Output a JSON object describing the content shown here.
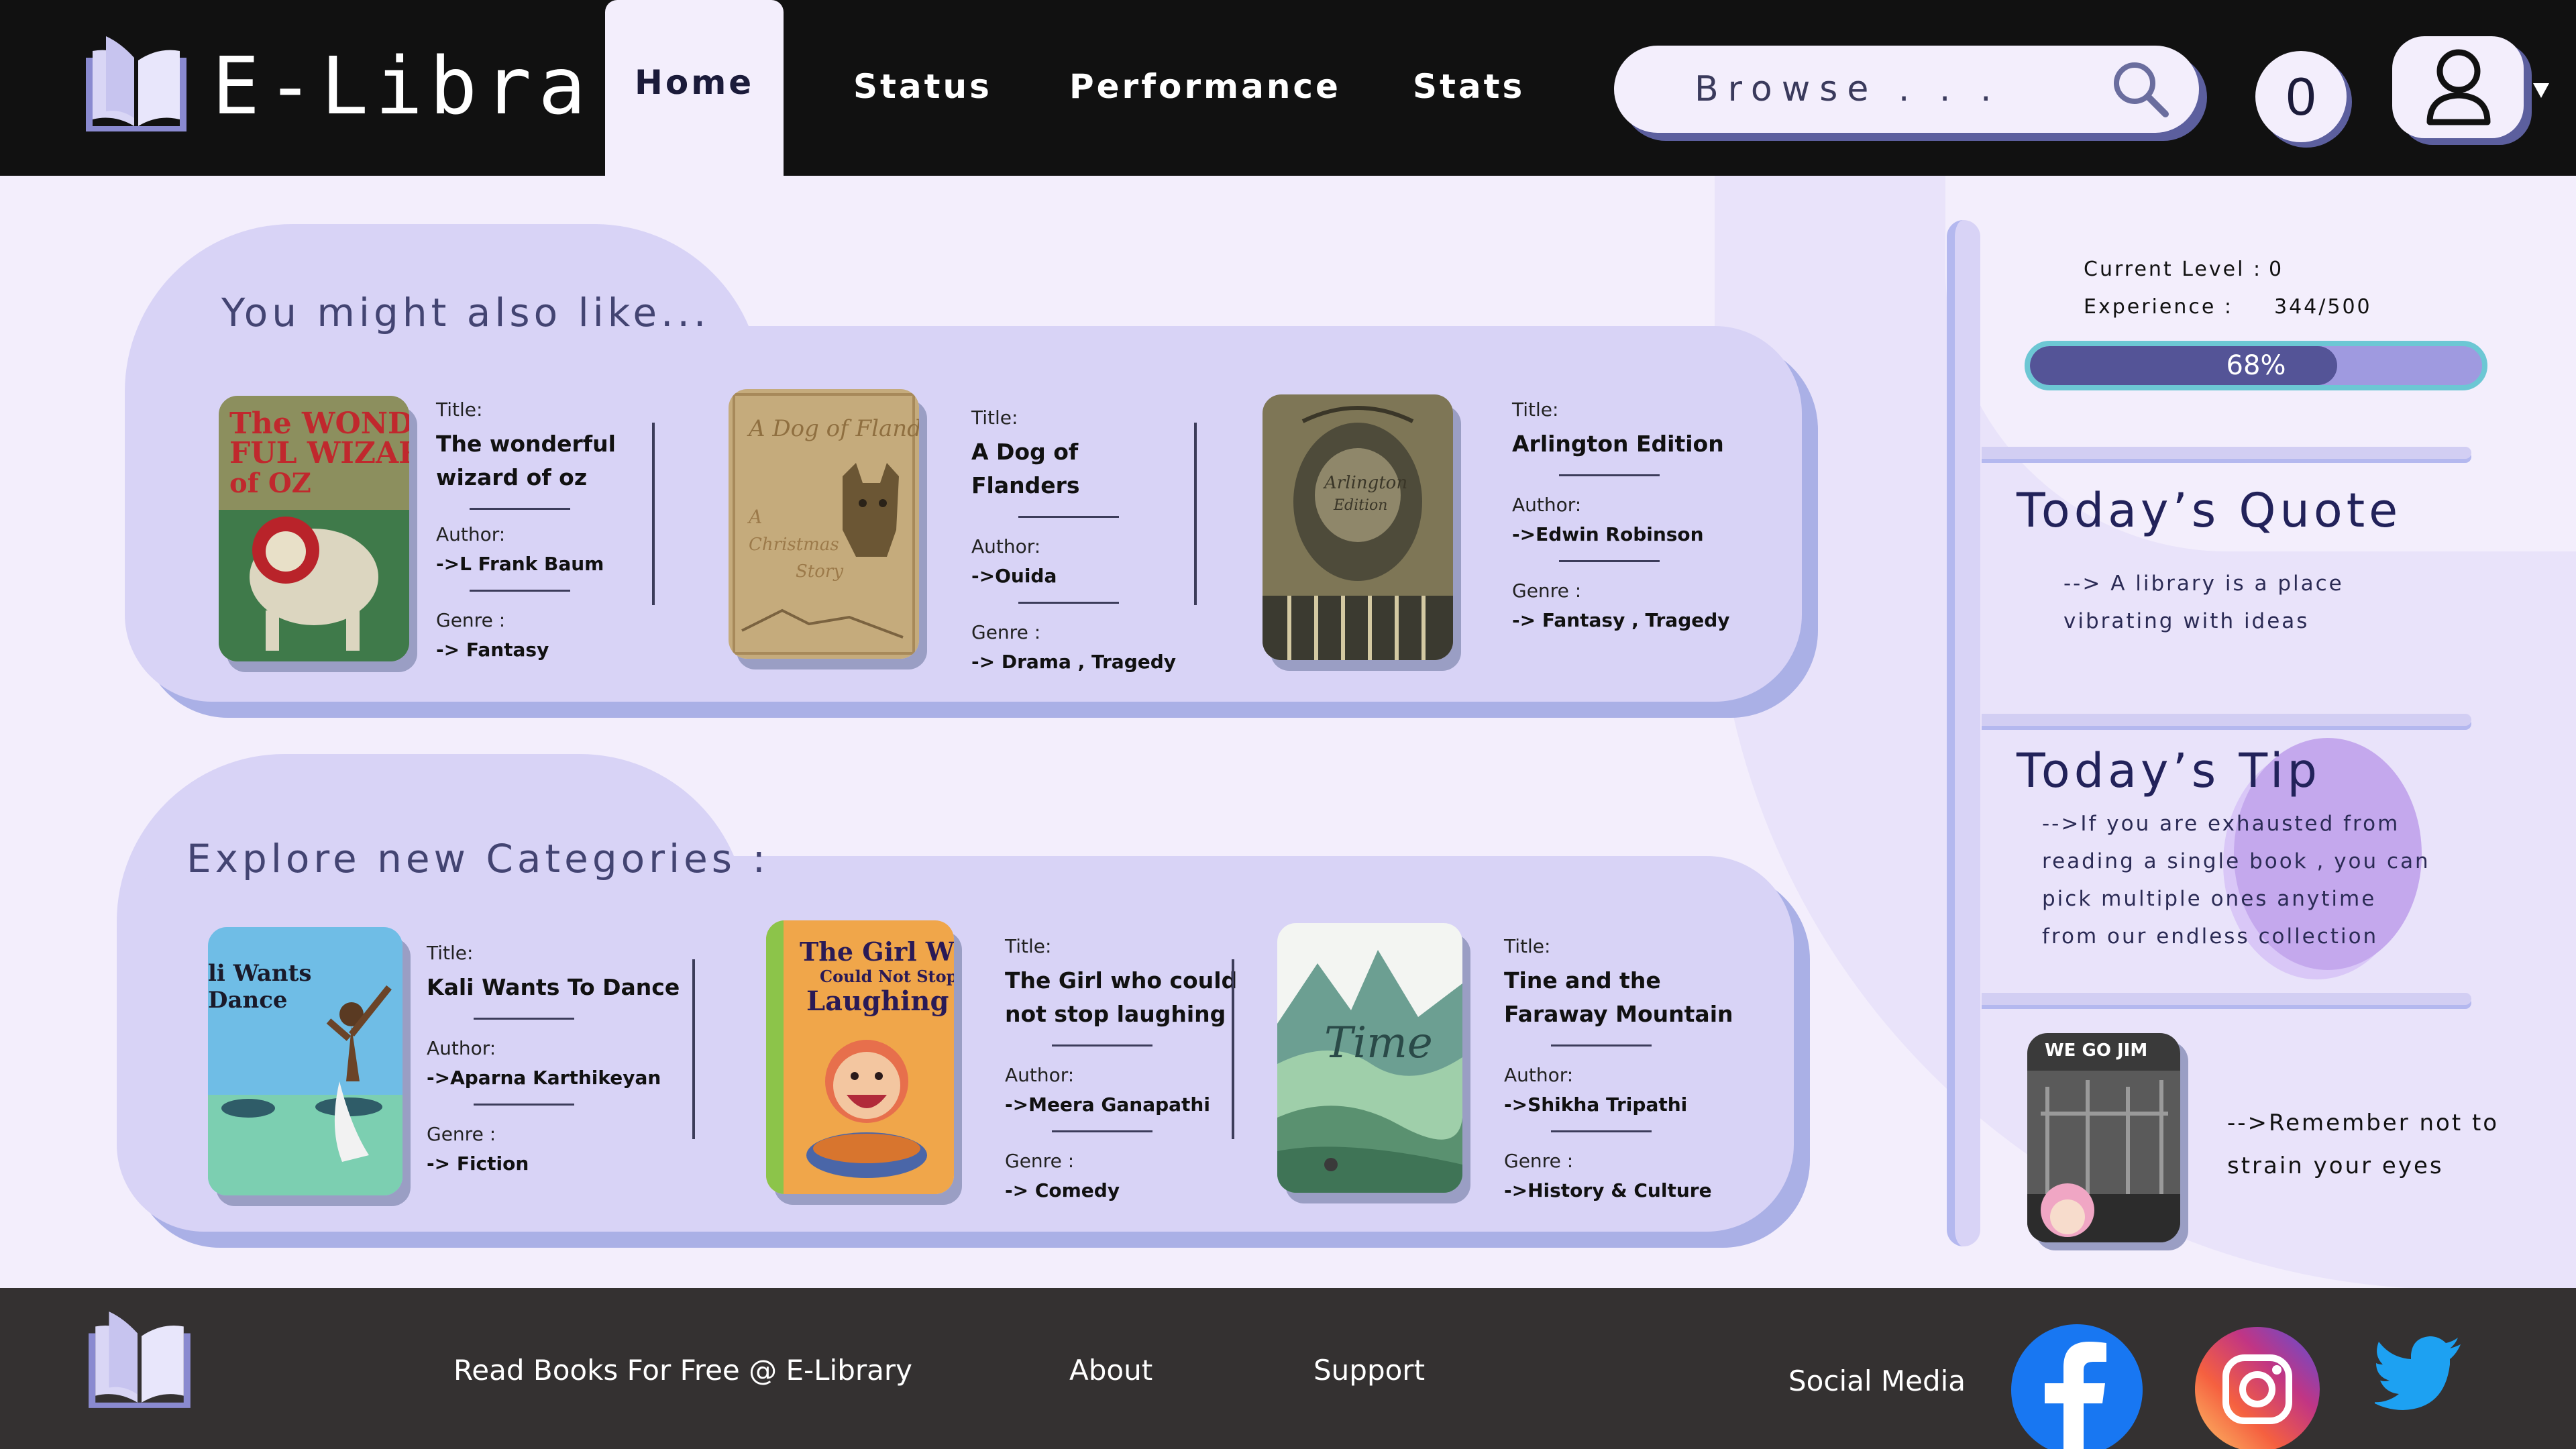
{
  "header": {
    "brand": "E-Library",
    "nav": [
      "Home",
      "Status",
      "Performance",
      "Stats"
    ],
    "search_placeholder": "Browse . . .",
    "notification_count": "0"
  },
  "recommendations": {
    "title": "You might also like...",
    "books": [
      {
        "title_label": "Title:",
        "title": "The wonderful wizard of oz",
        "author_label": "Author:",
        "author": "->L Frank Baum",
        "genre_label": "Genre :",
        "genre": "-> Fantasy",
        "cover_text": "The WONDERFUL WIZARD of OZ"
      },
      {
        "title_label": "Title:",
        "title": "A Dog of Flanders",
        "author_label": "Author:",
        "author": "->Ouida",
        "genre_label": "Genre :",
        "genre": "-> Drama , Tragedy",
        "cover_text": "A Dog of Flanders"
      },
      {
        "title_label": "Title:",
        "title": "Arlington Edition",
        "author_label": "Author:",
        "author": "->Edwin Robinson",
        "genre_label": "Genre :",
        "genre": "->  Fantasy , Tragedy",
        "cover_text": "Arlington Edition"
      }
    ]
  },
  "categories": {
    "title": "Explore new Categories :",
    "books": [
      {
        "title_label": "Title:",
        "title": "Kali Wants To Dance",
        "author_label": "Author:",
        "author": "->Aparna Karthikeyan",
        "genre_label": "Genre :",
        "genre": "-> Fiction",
        "cover_text": "li Wants Dance"
      },
      {
        "title_label": "Title:",
        "title": "The Girl who could not stop laughing",
        "author_label": "Author:",
        "author": "->Meera Ganapathi",
        "genre_label": "Genre :",
        "genre": "-> Comedy",
        "cover_text": "The Girl Who Could Not Stop Laughing"
      },
      {
        "title_label": "Title:",
        "title": "Tine and the Faraway Mountain",
        "author_label": "Author:",
        "author": "->Shikha Tripathi",
        "genre_label": "Genre :",
        "genre": "->History & Culture",
        "cover_text": "Time"
      }
    ]
  },
  "sidebar": {
    "level_label": "Current Level  :",
    "level_value": "0",
    "exp_label": "Experience       :",
    "exp_value": "344/500",
    "progress_percent": 68,
    "progress_text": "68%",
    "quote_heading": "Today’s Quote",
    "quote_line1": "--> A library is a place",
    "quote_line2": "vibrating with ideas",
    "tip_heading": "Today’s Tip",
    "tip_lines": [
      "-->If you are exhausted from",
      "reading a single book , you can",
      "pick multiple ones anytime",
      "from our endless collection"
    ],
    "gym_caption": "WE GO JIM",
    "reminder_line1": "-->Remember not to",
    "reminder_line2": "strain your eyes"
  },
  "footer": {
    "tagline": "Read Books For Free @ E-Library",
    "about": "About",
    "support": "Support",
    "social_label": "Social Media"
  },
  "colors": {
    "header_bg": "#111111",
    "page_bg": "#f3eefc",
    "card_bg": "#d8d3f6",
    "accent": "#545497",
    "footer_bg": "#343131",
    "facebook": "#1877f2",
    "twitter": "#1da1f2"
  },
  "icons": [
    "book-logo-icon",
    "search-icon",
    "user-icon",
    "caret-down-icon",
    "facebook-icon",
    "instagram-icon",
    "twitter-icon"
  ]
}
